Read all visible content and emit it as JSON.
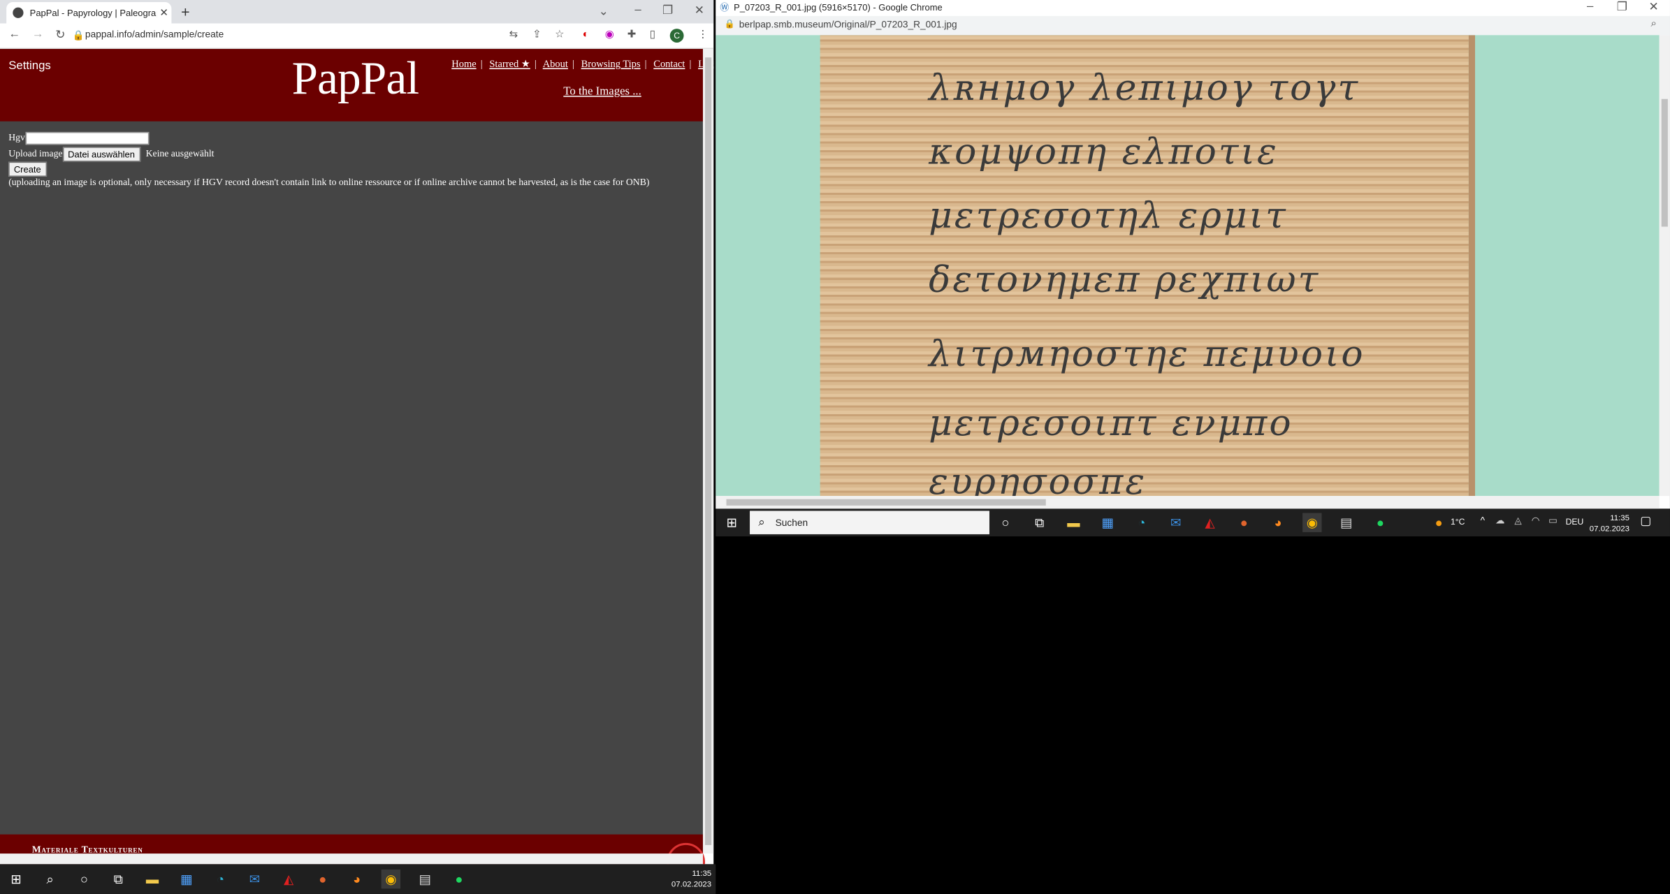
{
  "left_window": {
    "tab_title": "PapPal - Papyrology | Paleograph",
    "url": "pappal.info/admin/sample/create",
    "header": {
      "settings": "Settings",
      "logo": "PapPal",
      "menu": [
        "Home",
        "Starred ★",
        "About",
        "Browsing Tips",
        "Contact",
        "Logou"
      ],
      "to_images": "To the Images ..."
    },
    "form": {
      "hgv_label": "Hgv",
      "upload_label": "Upload image",
      "file_button": "Datei auswählen",
      "file_status": "Keine ausgewählt",
      "create_button": "Create",
      "note": "(uploading an image is optional, only necessary if HGV record doesn't contain link to online ressource or if online archive cannot be harvested, as is the case for ONB)"
    },
    "footer": "Materiale Textkulturen"
  },
  "left_taskbar": {
    "time": "11:35",
    "date": "07.02.2023"
  },
  "right_window": {
    "title": "P_07203_R_001.jpg (5916×5170) - Google Chrome",
    "url": "berlpap.smb.museum/Original/P_07203_R_001.jpg"
  },
  "right_taskbar": {
    "search": "Suchen",
    "weather": "1°C",
    "lang": "DEU",
    "time": "11:35",
    "date": "07.02.2023"
  }
}
